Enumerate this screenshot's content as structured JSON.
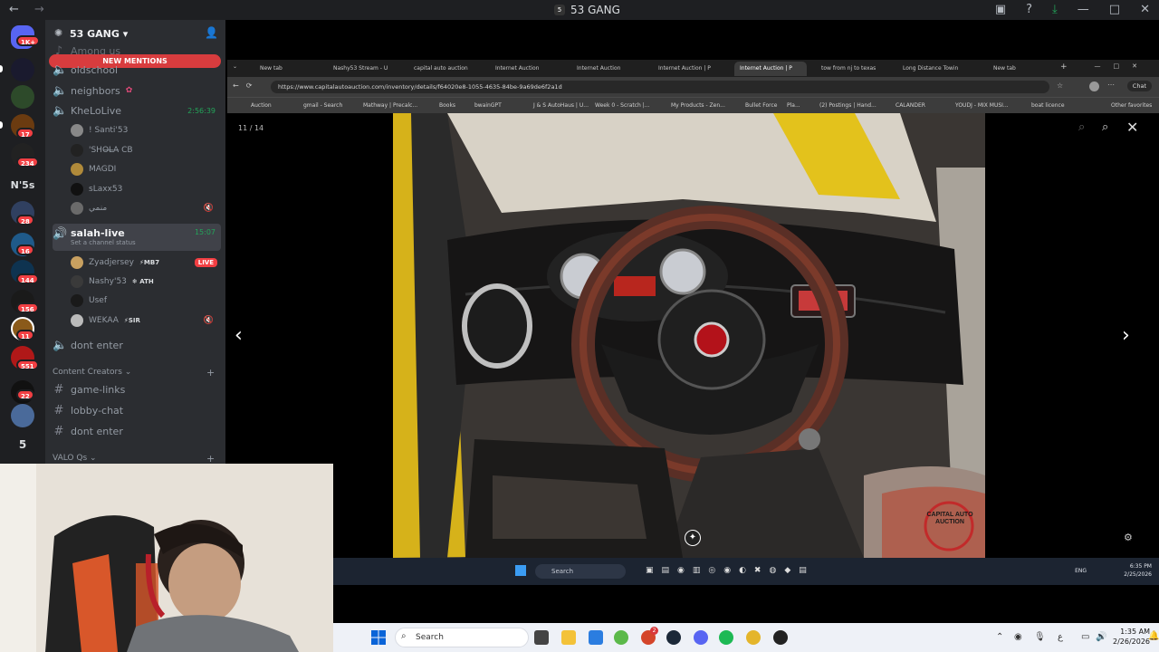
{
  "titlebar": {
    "title": "53 GANG",
    "back_icon": "arrow-left-icon",
    "forward_icon": "arrow-right-icon"
  },
  "rail": {
    "badges": [
      "1K+",
      "17",
      "234",
      "28",
      "16",
      "144",
      "156",
      "11",
      "551",
      "22"
    ],
    "text_items": [
      "N'5s",
      "5"
    ]
  },
  "sidebar": {
    "server_name": "53 GANG",
    "new_mentions": "NEW MENTIONS",
    "partial_top": "Among us",
    "channels": [
      {
        "name": "oldschool"
      },
      {
        "name": "neighbors"
      },
      {
        "name": "KheLoLive",
        "time": "2:56:39"
      }
    ],
    "khelo_users": [
      "! Santi'53",
      "'SHO̶L̶A̶‪ CB",
      "MAGDI",
      "sLaxx53",
      "منمي"
    ],
    "salah": {
      "name": "salah-live",
      "time": "15:07",
      "status": "Set a channel status"
    },
    "salah_users": [
      {
        "name": "Zyadjersey",
        "tag": "⚡MB7",
        "live": "LIVE"
      },
      {
        "name": "Nashy'53",
        "tag": "❄ ATH"
      },
      {
        "name": "Usef",
        "tag": ""
      },
      {
        "name": "WEKAA",
        "tag": "⚡SIR"
      }
    ],
    "dont_enter_1": "dont enter",
    "category_creators": "Content Creators",
    "creator_channels": [
      "game-links",
      "lobby-chat",
      "dont enter"
    ],
    "category_valo": "VALO Qs"
  },
  "browser": {
    "tabs": [
      "New tab",
      "Nashy53 Stream - U",
      "capital auto auction",
      "Internet Auction",
      "Internet Auction",
      "Internet Auction | P",
      "Internet Auction | P",
      "tow from nj to texas",
      "Long Distance Towin",
      "New tab"
    ],
    "url": "https://www.capitalautoauction.com/inventory/details/f64020e8-1055-4635-84be-9a69de6f2a1d",
    "chat_label": "Chat",
    "bookmarks": [
      "Auction",
      "gmail - Search",
      "Mathway | Precalc...",
      "Books",
      "bwainGPT",
      "J & S AutoHaus | U...",
      "Week 0 - Scratch |...",
      "My Products - Zen...",
      "Bullet Force",
      "Pla...",
      "(2) Postings | Hand...",
      "CALANDER",
      "YOUDJ - MIX MUSI...",
      "boat licence"
    ],
    "other_favorites": "Other favorites",
    "counter": "11 / 14",
    "watermark": "CAPITAL AUTO AUCTION"
  },
  "inner_taskbar": {
    "search": "Search",
    "lang": "ENG",
    "time": "6:35 PM",
    "date": "2/25/2026"
  },
  "taskbar": {
    "search": "Search",
    "time": "1:35 AM",
    "date": "2/26/2026",
    "spotify_badge": "2"
  },
  "colors": {
    "discord_dark": "#1e1f22",
    "sidebar": "#2b2d31",
    "mention_red": "#d83c3e",
    "live_green": "#23a55a",
    "car_yellow": "#e8c21a"
  }
}
